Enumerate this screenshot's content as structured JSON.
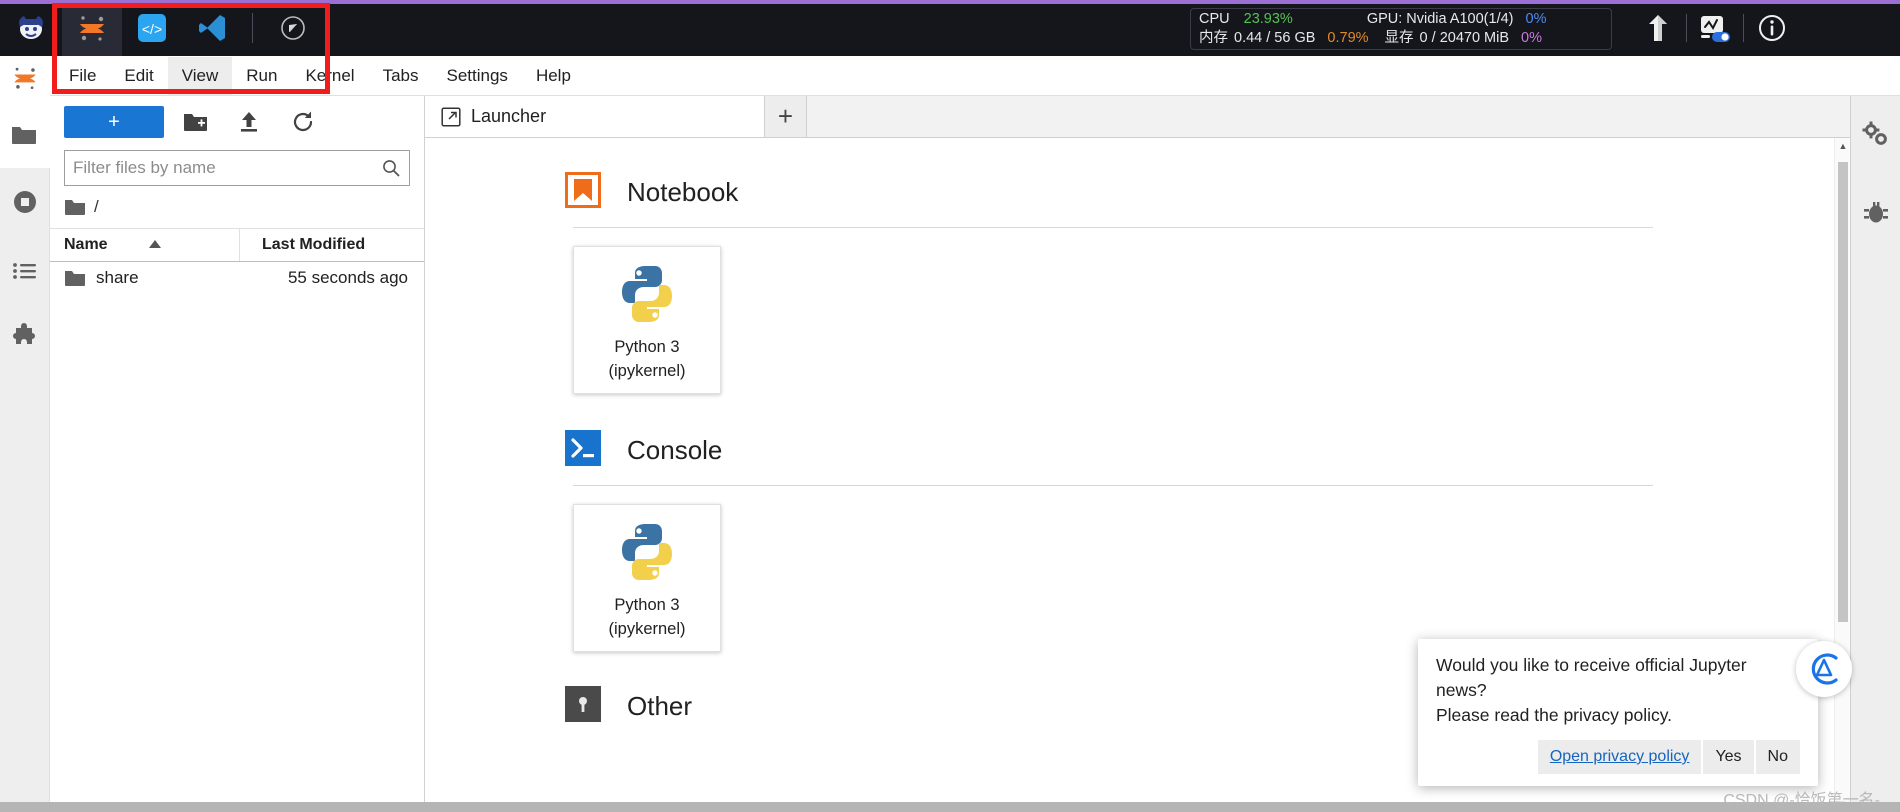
{
  "topbar": {
    "accent_color": "#9b6fd4",
    "background": "#15161c",
    "app_icons": [
      {
        "name": "pepper-logo-icon",
        "label": "Pepper"
      },
      {
        "name": "jupyter-icon",
        "label": "JupyterLab"
      },
      {
        "name": "code-server-icon",
        "label": "code-server"
      },
      {
        "name": "vscode-icon",
        "label": "VS Code"
      },
      {
        "name": "compass-icon",
        "label": "Compass"
      }
    ],
    "status": {
      "cpu_label": "CPU",
      "cpu_value": "23.93%",
      "cpu_color": "#54c254",
      "gpu_label": "GPU: Nvidia A100(1/4)",
      "gpu_value": "0%",
      "gpu_color": "#4d8bf0",
      "mem_label": "内存",
      "mem_value": "0.44 / 56 GB",
      "mem_pct": "0.79%",
      "mem_pct_color": "#e08b2a",
      "vram_label": "显存",
      "vram_value": "0 / 20470 MiB",
      "vram_pct": "0%",
      "vram_pct_color": "#c77ae0"
    },
    "right_icons": [
      {
        "name": "tensorboard-icon",
        "label": "TensorBoard"
      },
      {
        "name": "monitor-toggle-icon",
        "label": "Resource monitor"
      },
      {
        "name": "info-icon",
        "label": "Info"
      }
    ]
  },
  "menubar": {
    "items": [
      {
        "label": "File",
        "active": false
      },
      {
        "label": "Edit",
        "active": false
      },
      {
        "label": "View",
        "active": true
      },
      {
        "label": "Run",
        "active": false
      },
      {
        "label": "Kernel",
        "active": false
      },
      {
        "label": "Tabs",
        "active": false
      },
      {
        "label": "Settings",
        "active": false
      },
      {
        "label": "Help",
        "active": false
      }
    ]
  },
  "activitybar": {
    "items": [
      {
        "name": "file-browser-icon",
        "label": "File Browser",
        "active": true
      },
      {
        "name": "running-terminals-icon",
        "label": "Running Terminals and Kernels",
        "active": false
      },
      {
        "name": "commands-list-icon",
        "label": "Commands",
        "active": false
      },
      {
        "name": "extensions-puzzle-icon",
        "label": "Extension Manager",
        "active": false
      }
    ]
  },
  "filebrowser": {
    "new_button_label": "+",
    "toolbar_icons": [
      {
        "name": "new-folder-icon",
        "label": "New Folder"
      },
      {
        "name": "upload-icon",
        "label": "Upload Files"
      },
      {
        "name": "refresh-icon",
        "label": "Refresh File List"
      }
    ],
    "filter_placeholder": "Filter files by name",
    "filter_value": "",
    "breadcrumb": "/",
    "columns": [
      "Name",
      "Last Modified"
    ],
    "sort_column": "Name",
    "sort_direction": "asc",
    "rows": [
      {
        "name": "share",
        "modified": "55 seconds ago",
        "type": "folder"
      }
    ]
  },
  "maindock": {
    "tabs": [
      {
        "label": "Launcher",
        "icon": "launcher-icon",
        "active": true
      }
    ],
    "add_tab_label": "+",
    "launcher": {
      "sections": [
        {
          "title": "Notebook",
          "icon": "notebook-icon",
          "cards": [
            {
              "line1": "Python 3",
              "line2": "(ipykernel)",
              "icon": "python-logo-icon"
            }
          ]
        },
        {
          "title": "Console",
          "icon": "console-icon",
          "cards": [
            {
              "line1": "Python 3",
              "line2": "(ipykernel)",
              "icon": "python-logo-icon"
            }
          ]
        },
        {
          "title": "Other",
          "icon": "other-icon",
          "cards": []
        }
      ]
    }
  },
  "rightbar": {
    "items": [
      {
        "name": "property-inspector-icon",
        "label": "Property Inspector"
      },
      {
        "name": "debugger-icon",
        "label": "Debugger"
      }
    ]
  },
  "notification": {
    "line1": "Would you like to receive official Jupyter",
    "line2": "news?",
    "line3": "Please read the privacy policy.",
    "buttons": [
      {
        "label": "Open privacy policy",
        "style": "link"
      },
      {
        "label": "Yes",
        "style": "normal"
      },
      {
        "label": "No",
        "style": "normal"
      }
    ],
    "avatar_icon": "jupyter-news-avatar-icon"
  },
  "watermark": "CSDN @-恰饭第一名-",
  "annotation": {
    "name": "red-highlight-box",
    "color": "#f11c1c"
  }
}
